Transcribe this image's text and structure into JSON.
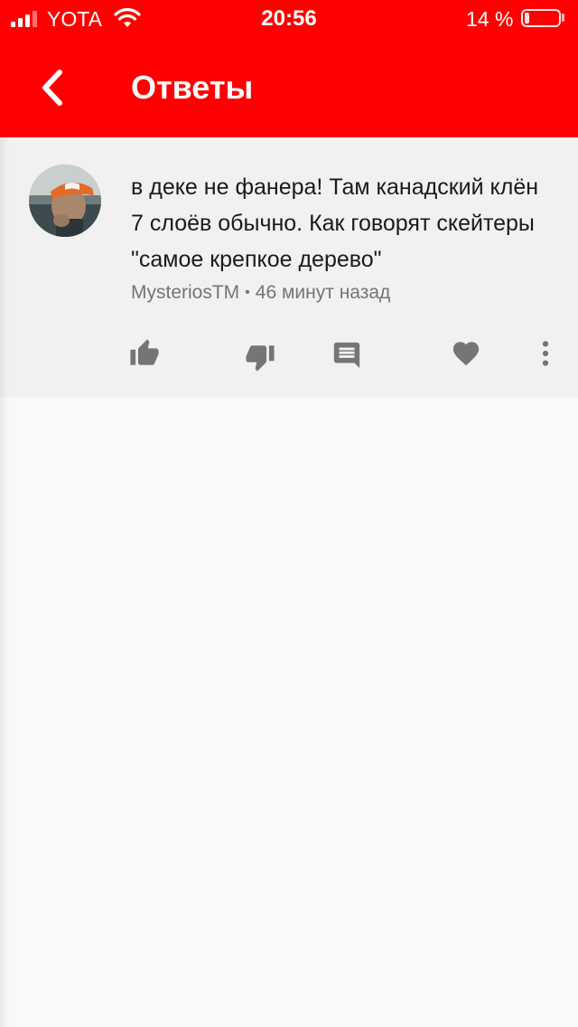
{
  "status_bar": {
    "carrier": "YOTA",
    "time": "20:56",
    "battery_percent": "14 %",
    "battery_level": 0.14,
    "signal_bars": 4,
    "signal_bars_filled": 3
  },
  "header": {
    "title": "Ответы",
    "background_color": "#ff0000",
    "back_icon": "chevron-left-icon"
  },
  "comment": {
    "text": "в деке не фанера! Там канадский клён 7 слоёв обычно. Как говорят скейтеры \"самое крепкое дерево\"",
    "author": "MysteriosTM",
    "separator": "•",
    "time_ago": "46 минут назад",
    "actions": [
      {
        "icon": "thumb-up-icon"
      },
      {
        "icon": "thumb-down-icon"
      },
      {
        "icon": "comment-icon"
      },
      {
        "icon": "heart-icon"
      },
      {
        "icon": "more-vertical-icon"
      }
    ],
    "icon_color": "#757575"
  }
}
